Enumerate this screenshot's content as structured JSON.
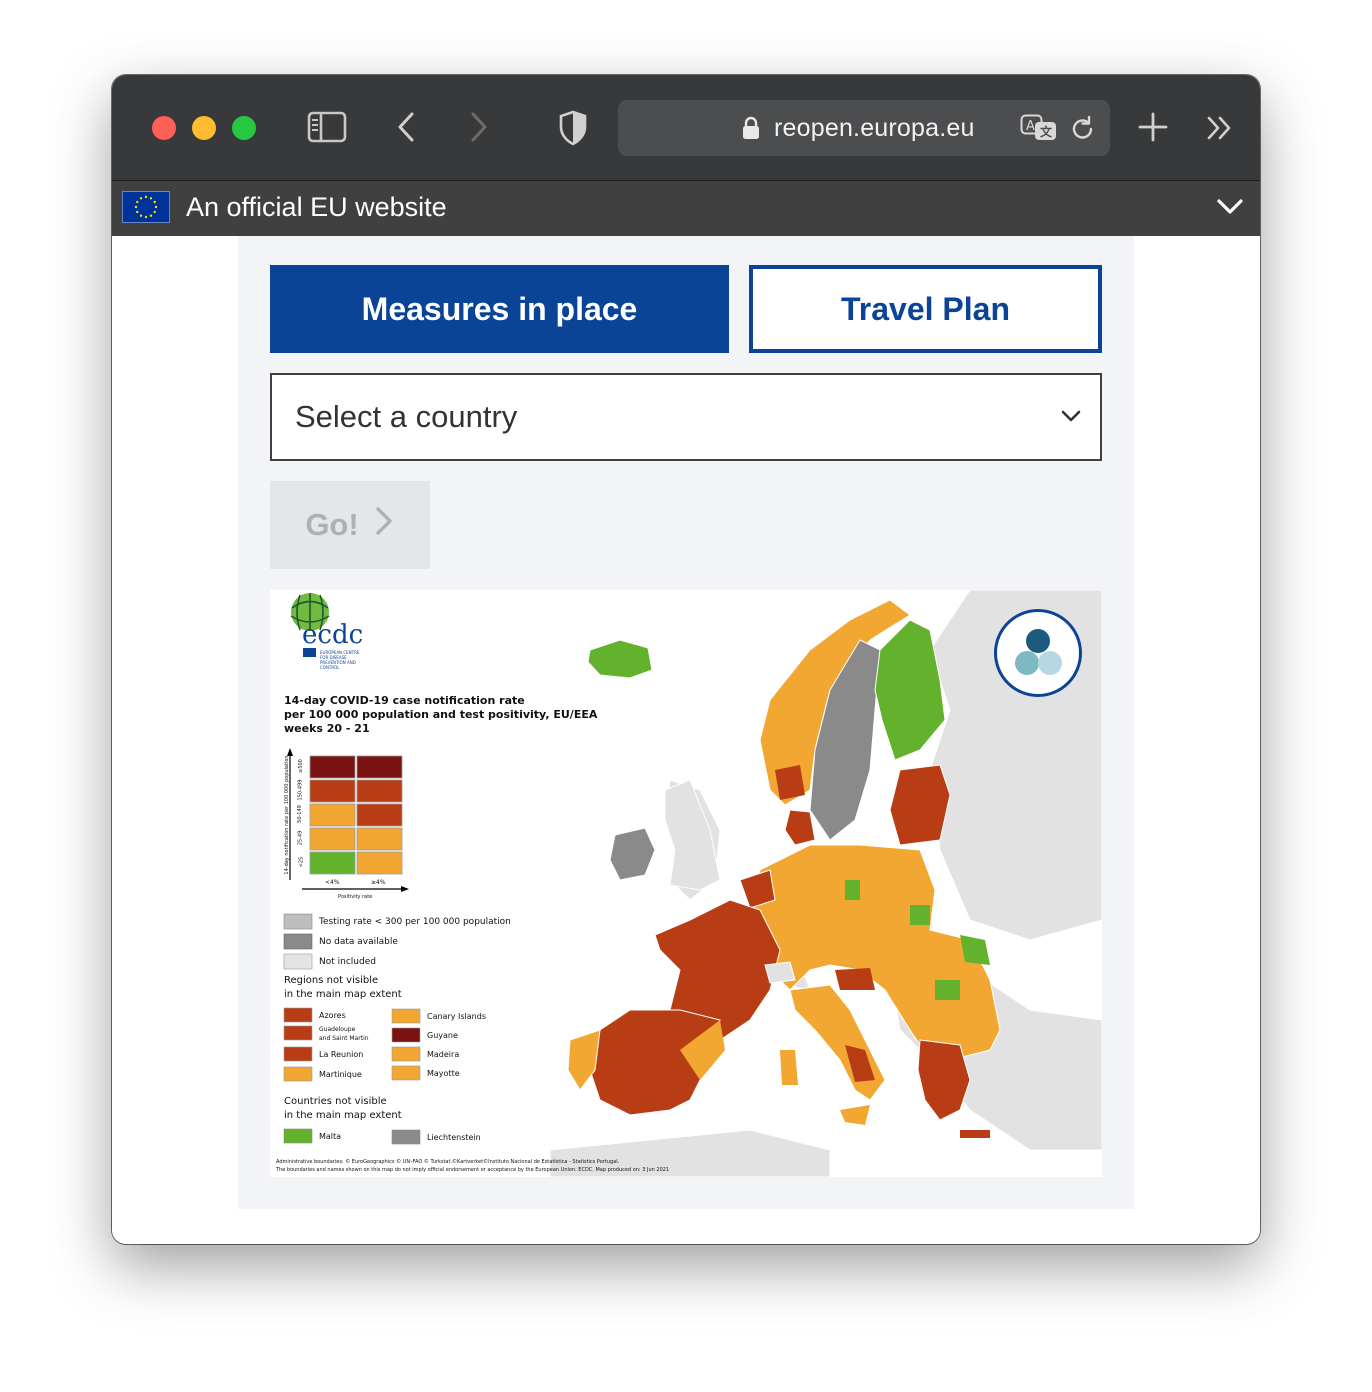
{
  "browser": {
    "url": "reopen.europa.eu",
    "icons": {
      "sidebar": "sidebar-icon",
      "back": "chevron-left-icon",
      "forward": "chevron-right-icon",
      "shield": "shield-icon",
      "lock": "lock-icon",
      "translate": "translate-icon",
      "reload": "reload-icon",
      "new_tab": "plus-icon",
      "more": "double-chevron-icon"
    }
  },
  "eu_banner": {
    "text": "An official EU website",
    "expand_icon": "chevron-down-icon"
  },
  "actions": {
    "measures_label": "Measures in place",
    "travel_label": "Travel Plan",
    "country_select": {
      "selected": "Select a country"
    },
    "go_label": "Go!"
  },
  "colors": {
    "eu_blue": "#0b4497",
    "dark_red": "#7a1212",
    "red": "#b83d14",
    "orange": "#f1a731",
    "green": "#63b22d",
    "grey_testing": "#bdbdbd",
    "grey_nodata": "#8a8a8a",
    "grey_not_included": "#e4e4e4"
  },
  "map": {
    "logo_text": "ecdc",
    "logo_subtitle": "EUROPEAN CENTRE FOR DISEASE PREVENTION AND CONTROL",
    "title_line1": "14-day COVID-19 case notification rate",
    "title_line2": "per 100 000 population and test positivity, EU/EEA",
    "title_line3": "weeks 20 - 21",
    "y_axis_label": "14-day notification rate per 100 000 population",
    "y_ticks": [
      "≥500",
      "150-499",
      "50-149",
      "25-49",
      "<25"
    ],
    "x_ticks": [
      "<4%",
      "≥4%"
    ],
    "x_axis_label": "Positivity rate",
    "legend_grey": [
      "Testing rate < 300 per 100 000 population",
      "No data available",
      "Not included"
    ],
    "regions_heading_1": "Regions not visible",
    "regions_heading_2": "in the main map extent",
    "regions": [
      {
        "name": "Azores",
        "color": "#b83d14"
      },
      {
        "name": "Canary Islands",
        "color": "#f1a731"
      },
      {
        "name": "Guadeloupe",
        "name2": "and Saint Martin",
        "color": "#b83d14"
      },
      {
        "name": "Guyane",
        "color": "#7a1212"
      },
      {
        "name": "La Reunion",
        "color": "#b83d14"
      },
      {
        "name": "Madeira",
        "color": "#f1a731"
      },
      {
        "name": "Martinique",
        "color": "#f1a731"
      },
      {
        "name": "Mayotte",
        "color": "#f1a731"
      }
    ],
    "countries_heading_1": "Countries not visible",
    "countries_heading_2": "in the main map extent",
    "countries": [
      {
        "name": "Malta",
        "color": "#63b22d"
      },
      {
        "name": "Liechtenstein",
        "color": "#8a8a8a"
      }
    ],
    "footnote_1": "Administrative boundaries: © EuroGeographics © UN–FAO © Turkstat.©Kartverket©Instituto Nacional de Estatística - Statistics Portugal.",
    "footnote_2": "The boundaries and names shown on this map do not imply official endorsement or acceptance by the European Union. ECDC. Map produced on: 3 Jun 2021",
    "accessibility_icon": "accessibility-circles-icon"
  }
}
